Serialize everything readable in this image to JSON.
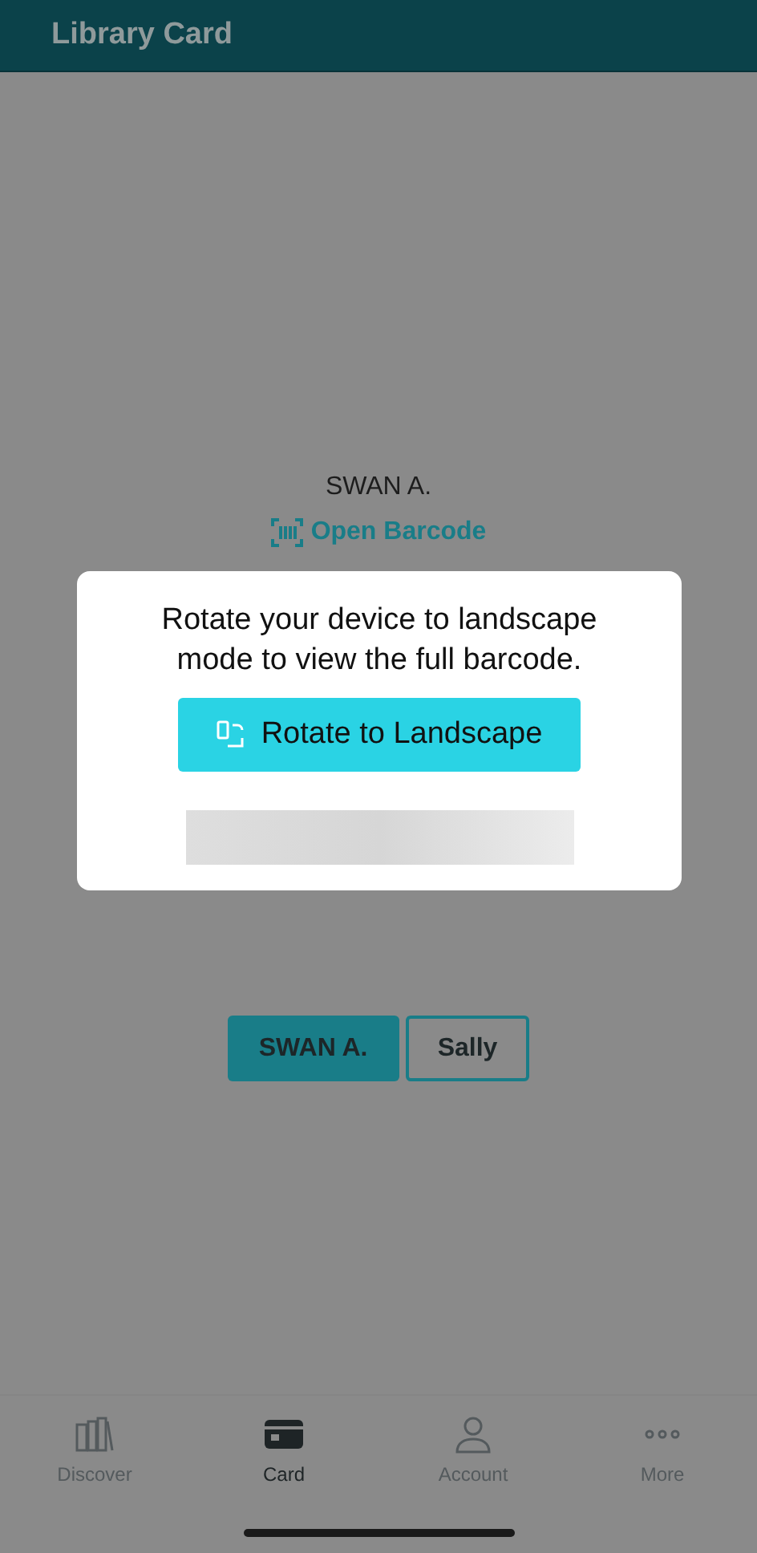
{
  "header": {
    "title": "Library Card"
  },
  "card": {
    "holder": "SWAN A.",
    "barcode_link": "Open Barcode"
  },
  "dialog": {
    "message": "Rotate your device to landscape mode to view the full barcode.",
    "button": "Rotate to Landscape"
  },
  "profiles": [
    {
      "label": "SWAN A.",
      "selected": true
    },
    {
      "label": "Sally",
      "selected": false
    }
  ],
  "tabs": [
    {
      "label": "Discover",
      "kind": "books",
      "selected": false
    },
    {
      "label": "Card",
      "kind": "card",
      "selected": true
    },
    {
      "label": "Account",
      "kind": "person",
      "selected": false
    },
    {
      "label": "More",
      "kind": "dots",
      "selected": false
    }
  ]
}
